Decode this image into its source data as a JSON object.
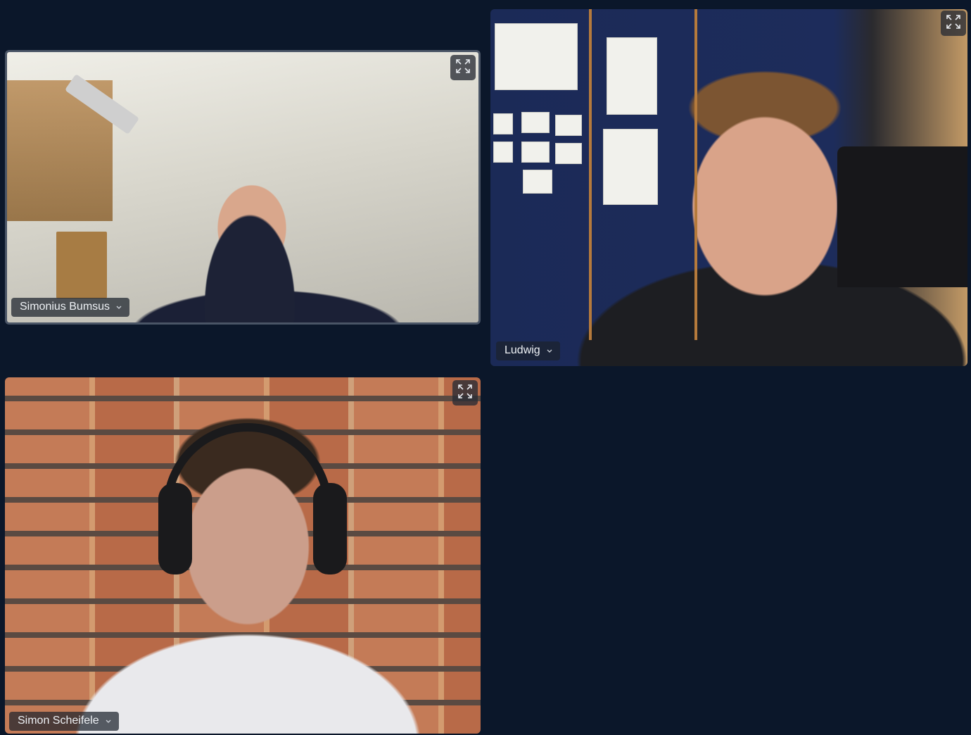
{
  "participants": [
    {
      "name": "Simonius Bumsus",
      "menu_icon": "chevron-down-icon",
      "expand_icon": "expand-icon"
    },
    {
      "name": "Ludwig",
      "menu_icon": "chevron-down-icon",
      "expand_icon": "expand-icon"
    },
    {
      "name": "Simon Scheifele",
      "menu_icon": "chevron-down-icon",
      "expand_icon": "expand-icon"
    }
  ],
  "colors": {
    "background": "#0b172a",
    "name_tag_bg": "#1c222c",
    "name_tag_text": "#eef1f5",
    "active_border": "#4a5566"
  }
}
